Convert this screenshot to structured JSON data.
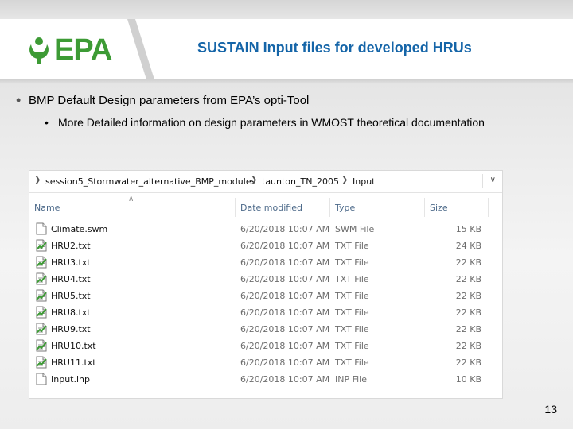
{
  "logo": {
    "text": "EPA",
    "color": "#3d9b35"
  },
  "title": "SUSTAIN Input files for developed HRUs",
  "bullets": {
    "level1": "BMP Default Design parameters from EPA’s opti-Tool",
    "level2": "More Detailed information on design parameters in WMOST theoretical documentation",
    "dot1": "•",
    "dot2": "•"
  },
  "explorer": {
    "breadcrumb": [
      "session5_Stormwater_alternative_BMP_modules",
      "taunton_TN_2005",
      "Input"
    ],
    "columns": {
      "name": "Name",
      "date": "Date modified",
      "type": "Type",
      "size": "Size"
    },
    "files": [
      {
        "name": "Climate.swm",
        "date": "6/20/2018 10:07 AM",
        "type": "SWM File",
        "size": "15 KB",
        "icon": "blank-file-icon"
      },
      {
        "name": "HRU2.txt",
        "date": "6/20/2018 10:07 AM",
        "type": "TXT File",
        "size": "24 KB",
        "icon": "text-file-icon"
      },
      {
        "name": "HRU3.txt",
        "date": "6/20/2018 10:07 AM",
        "type": "TXT File",
        "size": "22 KB",
        "icon": "text-file-icon"
      },
      {
        "name": "HRU4.txt",
        "date": "6/20/2018 10:07 AM",
        "type": "TXT File",
        "size": "22 KB",
        "icon": "text-file-icon"
      },
      {
        "name": "HRU5.txt",
        "date": "6/20/2018 10:07 AM",
        "type": "TXT File",
        "size": "22 KB",
        "icon": "text-file-icon"
      },
      {
        "name": "HRU8.txt",
        "date": "6/20/2018 10:07 AM",
        "type": "TXT File",
        "size": "22 KB",
        "icon": "text-file-icon"
      },
      {
        "name": "HRU9.txt",
        "date": "6/20/2018 10:07 AM",
        "type": "TXT File",
        "size": "22 KB",
        "icon": "text-file-icon"
      },
      {
        "name": "HRU10.txt",
        "date": "6/20/2018 10:07 AM",
        "type": "TXT File",
        "size": "22 KB",
        "icon": "text-file-icon"
      },
      {
        "name": "HRU11.txt",
        "date": "6/20/2018 10:07 AM",
        "type": "TXT File",
        "size": "22 KB",
        "icon": "text-file-icon"
      },
      {
        "name": "Input.inp",
        "date": "6/20/2018 10:07 AM",
        "type": "INP File",
        "size": "10 KB",
        "icon": "blank-file-icon"
      }
    ]
  },
  "page_number": "13",
  "colors": {
    "title": "#1565a8",
    "header_label": "#4d6a8a"
  }
}
